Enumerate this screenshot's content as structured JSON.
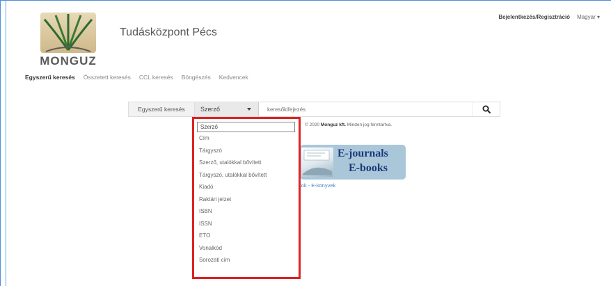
{
  "colors": {
    "accent_red": "#dd2222",
    "nav_active": "#333333",
    "banner_blue": "#1c3a7a"
  },
  "header": {
    "logo_text": "MONGUZ",
    "site_title": "Tudásközpont Pécs",
    "login": "Bejelentkezés/Regisztráció",
    "language": "Magyar"
  },
  "nav": {
    "items": [
      {
        "label": "Egyszerű keresés",
        "active": true
      },
      {
        "label": "Összetett keresés"
      },
      {
        "label": "CCL keresés"
      },
      {
        "label": "Böngészés"
      },
      {
        "label": "Kedvencek"
      }
    ]
  },
  "search": {
    "label": "Egyszerű keresés",
    "selected_field": "Szerző",
    "placeholder": "keresőkifejezés",
    "button_icon": "search-icon"
  },
  "dropdown": {
    "options": [
      "Szerző",
      "Cím",
      "Tárgyszó",
      "Szerző, utalókkal bővített",
      "Tárgyszó, utalókkal bővített",
      "Kiadó",
      "Raktári jelzet",
      "ISBN",
      "ISSN",
      "ETO",
      "Vonalkód",
      "Sorozati cím"
    ]
  },
  "footer": {
    "copyright_prefix": "© 2020",
    "copyright_company": "Monguz kft.",
    "copyright_suffix": "Minden jog fenntartva."
  },
  "banner": {
    "line1": "E-journals",
    "line2": "E-books",
    "link_text": "lok - E-könyvek"
  }
}
